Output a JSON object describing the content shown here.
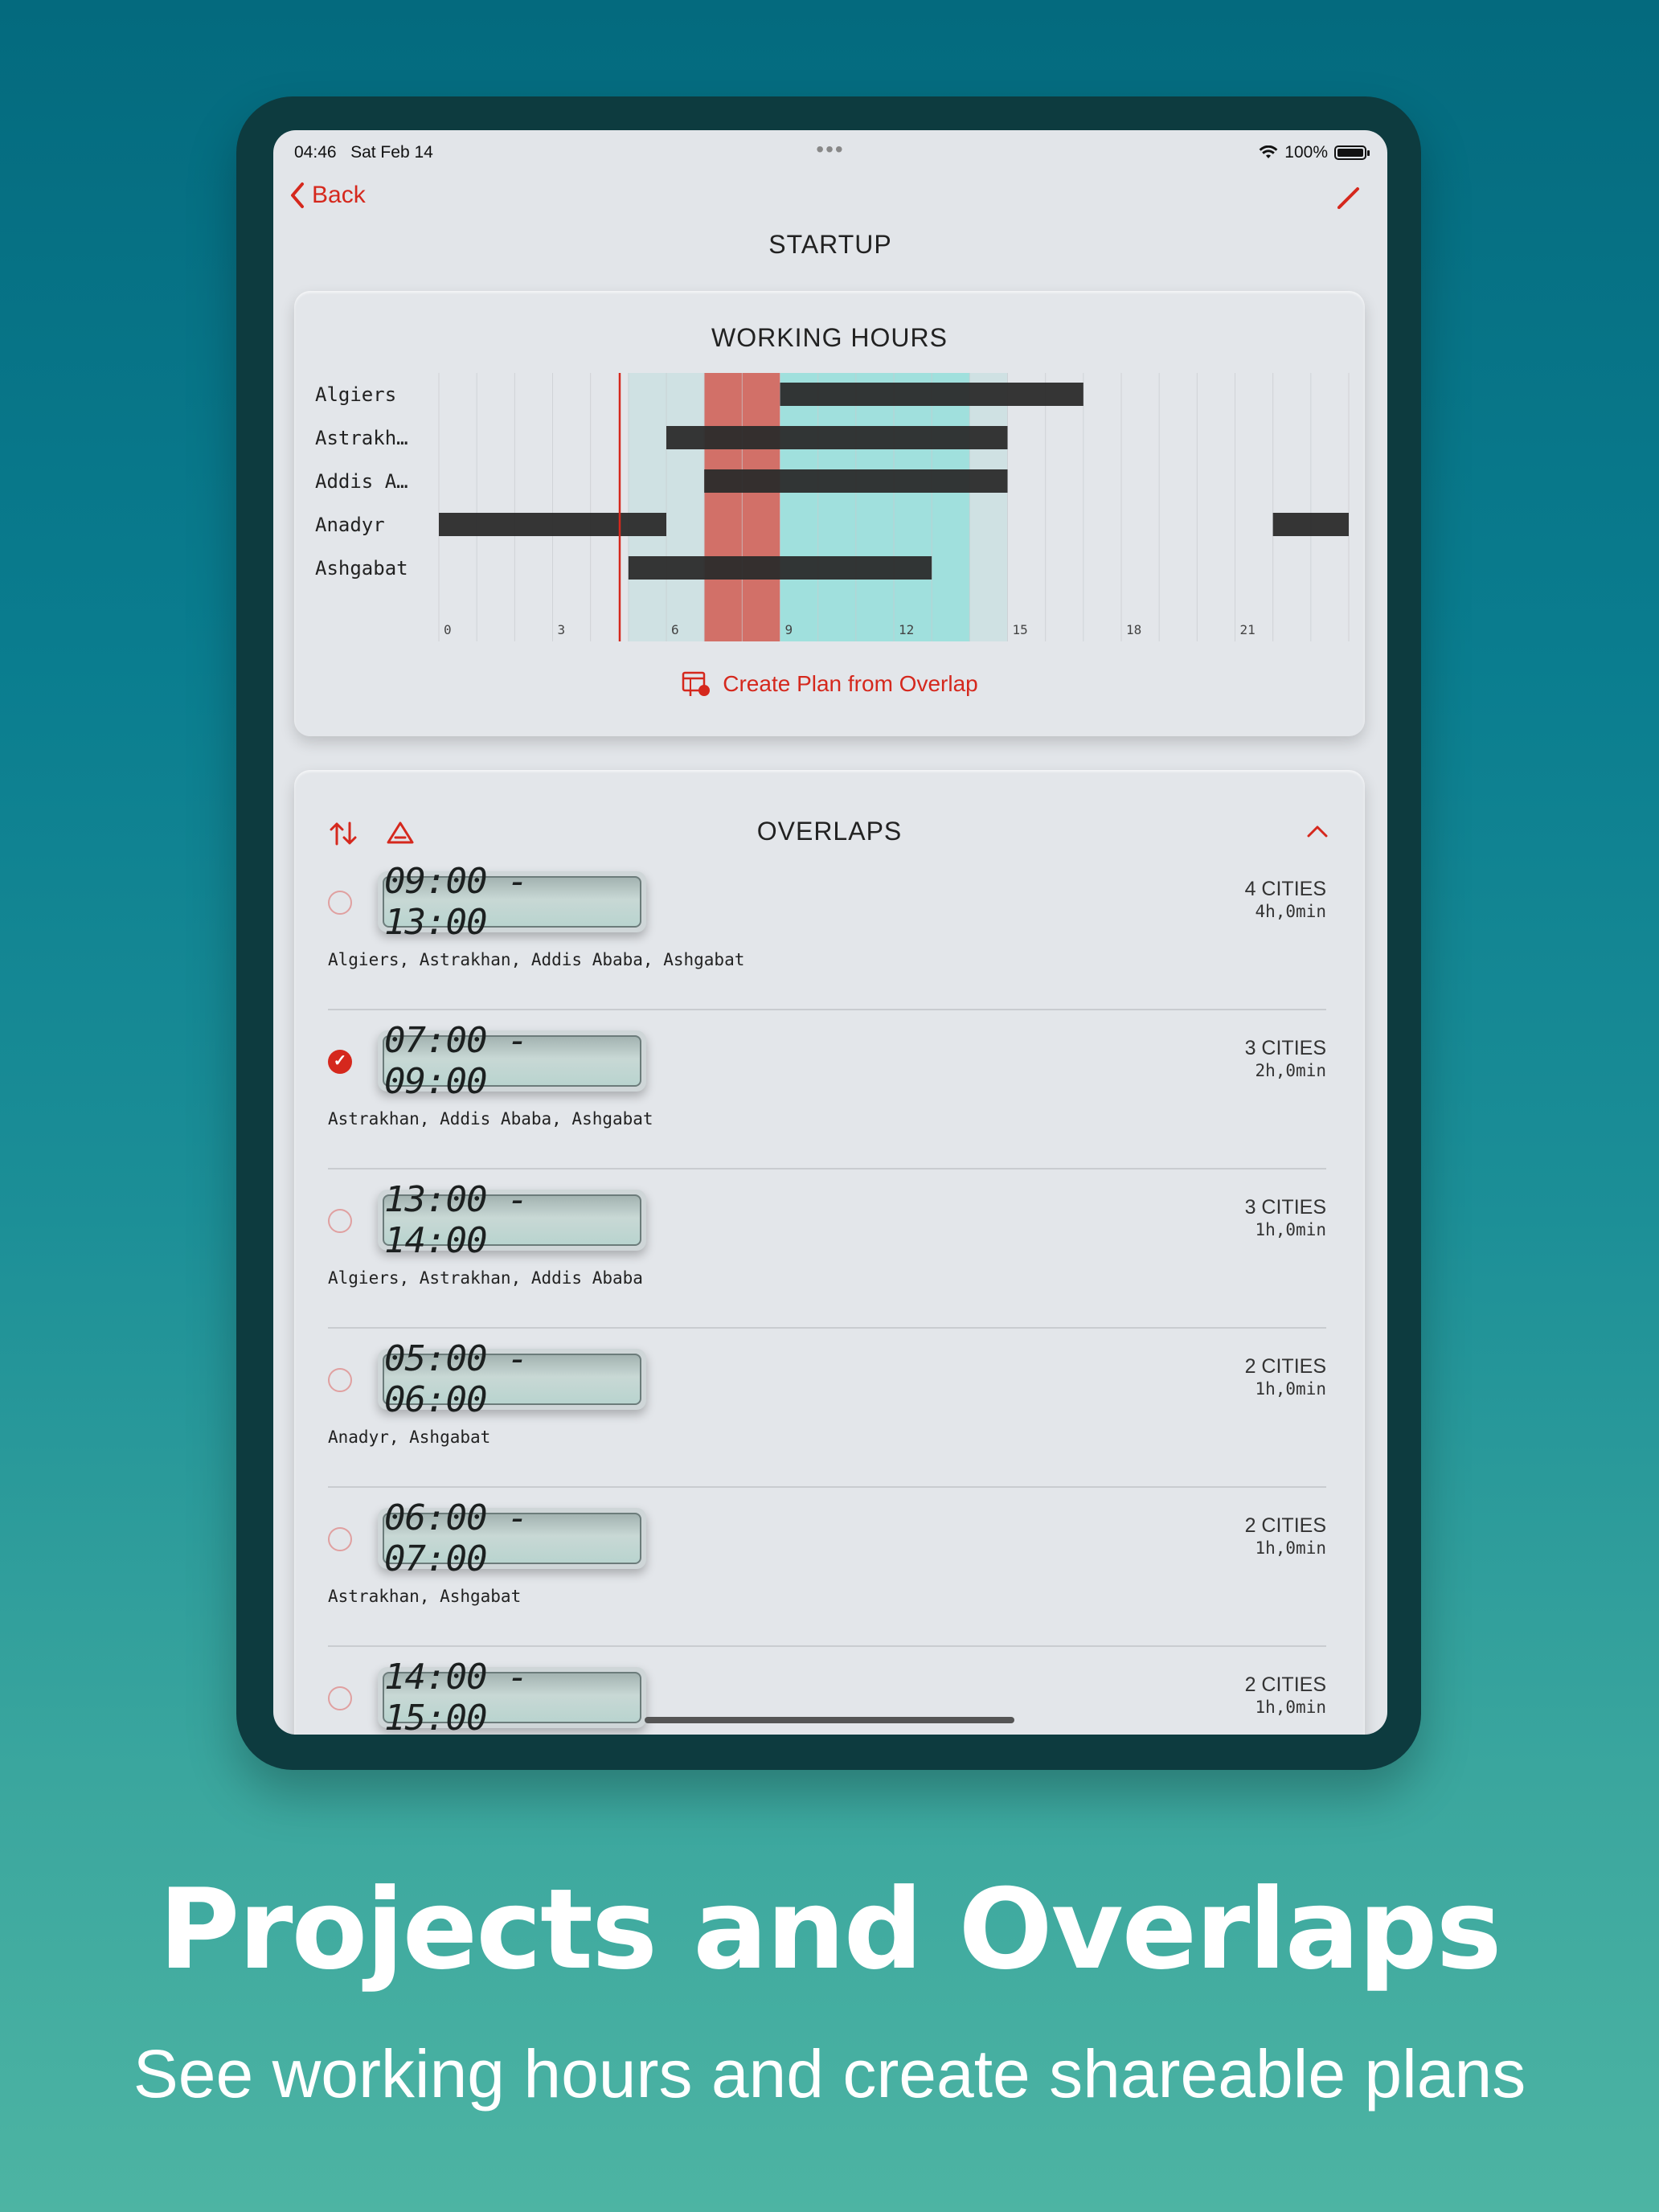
{
  "status_bar": {
    "time": "04:46",
    "date": "Sat Feb 14",
    "battery": "100%"
  },
  "nav": {
    "back_label": "Back",
    "title": "STARTUP"
  },
  "working_hours": {
    "title": "WORKING HOURS",
    "create_plan_label": "Create Plan from Overlap"
  },
  "chart_data": {
    "type": "bar",
    "orientation": "horizontal-range",
    "title": "WORKING HOURS",
    "categories": [
      "Algiers",
      "Astrakh…",
      "Addis A…",
      "Anadyr",
      "Ashgabat"
    ],
    "ranges": [
      [
        [
          9,
          17
        ]
      ],
      [
        [
          6,
          15
        ]
      ],
      [
        [
          7,
          15
        ]
      ],
      [
        [
          0,
          6
        ],
        [
          22,
          24
        ]
      ],
      [
        [
          5,
          13
        ]
      ]
    ],
    "x_ticks": [
      "0",
      "3",
      "6",
      "9",
      "12",
      "15",
      "18",
      "21"
    ],
    "xlim": [
      0,
      24
    ],
    "current_time": 4.77,
    "highlight_overlap": [
      7,
      9
    ],
    "shaded_region": [
      5,
      15
    ],
    "strong_shaded_region": [
      9,
      14
    ],
    "colors": {
      "bar": "#2b2b2b",
      "highlight": "#d27068",
      "shade": "#cfe1e3",
      "strong_shade": "#a0e0dd",
      "now_line": "#d5281d"
    }
  },
  "overlaps": {
    "title": "OVERLAPS",
    "items": [
      {
        "time": "09:00 - 13:00",
        "cities": "4 CITIES",
        "duration": "4h,0min",
        "names": "Algiers, Astrakhan, Addis Ababa, Ashgabat",
        "checked": false
      },
      {
        "time": "07:00 - 09:00",
        "cities": "3 CITIES",
        "duration": "2h,0min",
        "names": "Astrakhan, Addis Ababa, Ashgabat",
        "checked": true
      },
      {
        "time": "13:00 - 14:00",
        "cities": "3 CITIES",
        "duration": "1h,0min",
        "names": "Algiers, Astrakhan, Addis Ababa",
        "checked": false
      },
      {
        "time": "05:00 - 06:00",
        "cities": "2 CITIES",
        "duration": "1h,0min",
        "names": "Anadyr, Ashgabat",
        "checked": false
      },
      {
        "time": "06:00 - 07:00",
        "cities": "2 CITIES",
        "duration": "1h,0min",
        "names": "Astrakhan, Ashgabat",
        "checked": false
      },
      {
        "time": "14:00 - 15:00",
        "cities": "2 CITIES",
        "duration": "1h,0min",
        "names": "",
        "checked": false
      }
    ]
  },
  "marketing": {
    "headline": "Projects and Overlaps",
    "subline": "See working hours and create shareable plans"
  },
  "icons": [
    "back-chevron-icon",
    "pencil-icon",
    "plan-icon",
    "sort-icon",
    "warning-icon",
    "chevron-up-icon",
    "wifi-icon",
    "battery-icon"
  ]
}
